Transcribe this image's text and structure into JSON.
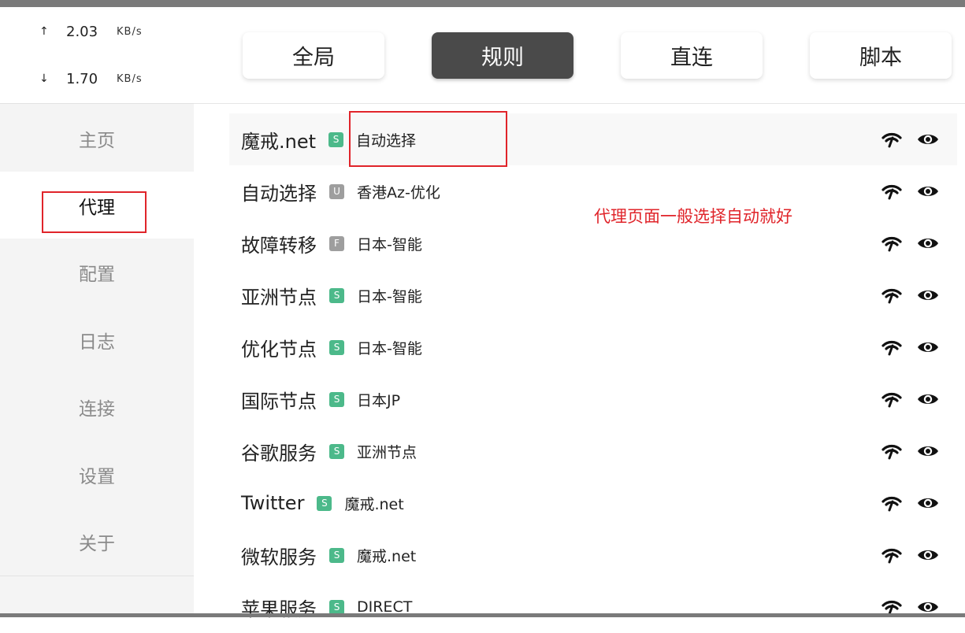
{
  "speed": {
    "upload": {
      "arrow": "↑",
      "value": "2.03",
      "unit": "KB/s"
    },
    "download": {
      "arrow": "↓",
      "value": "1.70",
      "unit": "KB/s"
    }
  },
  "nav": [
    {
      "label": "主页"
    },
    {
      "label": "代理"
    },
    {
      "label": "配置"
    },
    {
      "label": "日志"
    },
    {
      "label": "连接"
    },
    {
      "label": "设置"
    },
    {
      "label": "关于"
    }
  ],
  "modes": [
    {
      "label": "全局"
    },
    {
      "label": "规则"
    },
    {
      "label": "直连"
    },
    {
      "label": "脚本"
    }
  ],
  "badge_colors": {
    "S": "#4cb98a",
    "U": "#9e9e9e",
    "F": "#9e9e9e"
  },
  "groups": [
    {
      "name": "魔戒.net",
      "type": "S",
      "now": "自动选择"
    },
    {
      "name": "自动选择",
      "type": "U",
      "now": "香港Az-优化"
    },
    {
      "name": "故障转移",
      "type": "F",
      "now": "日本-智能"
    },
    {
      "name": "亚洲节点",
      "type": "S",
      "now": "日本-智能"
    },
    {
      "name": "优化节点",
      "type": "S",
      "now": "日本-智能"
    },
    {
      "name": "国际节点",
      "type": "S",
      "now": "日本JP"
    },
    {
      "name": "谷歌服务",
      "type": "S",
      "now": "亚洲节点"
    },
    {
      "name": "Twitter",
      "type": "S",
      "now": "魔戒.net"
    },
    {
      "name": "微软服务",
      "type": "S",
      "now": "魔戒.net"
    },
    {
      "name": "苹果服务",
      "type": "S",
      "now": "DIRECT"
    }
  ],
  "annotation": {
    "text": "代理页面一般选择自动就好",
    "color": "#e0242a"
  }
}
